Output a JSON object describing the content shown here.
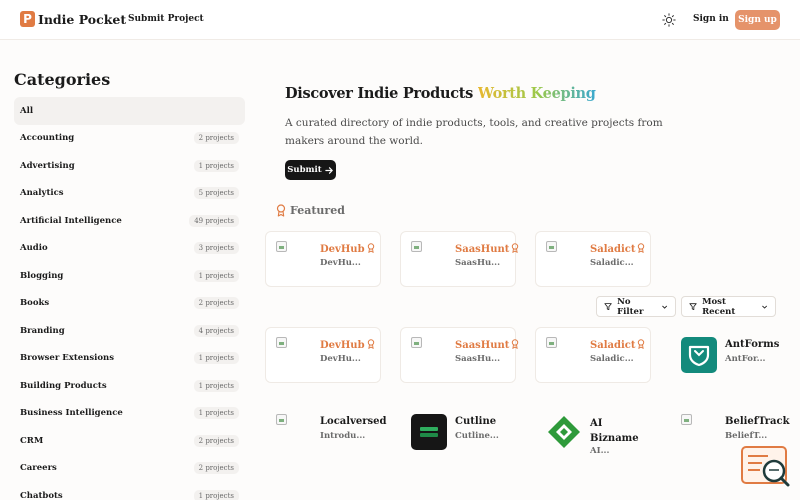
{
  "header": {
    "logo_letter": "P",
    "logo_text": "Indie Pocket",
    "nav_submit": "Submit Project",
    "signin": "Sign in",
    "signup": "Sign up"
  },
  "sidebar": {
    "title": "Categories",
    "items": [
      {
        "name": "All",
        "count": ""
      },
      {
        "name": "Accounting",
        "count": "2 projects"
      },
      {
        "name": "Advertising",
        "count": "1 projects"
      },
      {
        "name": "Analytics",
        "count": "5 projects"
      },
      {
        "name": "Artificial Intelligence",
        "count": "49 projects"
      },
      {
        "name": "Audio",
        "count": "3 projects"
      },
      {
        "name": "Blogging",
        "count": "1 projects"
      },
      {
        "name": "Books",
        "count": "2 projects"
      },
      {
        "name": "Branding",
        "count": "4 projects"
      },
      {
        "name": "Browser Extensions",
        "count": "1 projects"
      },
      {
        "name": "Building Products",
        "count": "1 projects"
      },
      {
        "name": "Business Intelligence",
        "count": "1 projects"
      },
      {
        "name": "CRM",
        "count": "2 projects"
      },
      {
        "name": "Careers",
        "count": "2 projects"
      },
      {
        "name": "Chatbots",
        "count": "1 projects"
      }
    ]
  },
  "hero": {
    "title_main": "Discover Indie Products ",
    "title_highlight": "Worth Keeping",
    "description": "A curated directory of indie products, tools, and creative projects from makers around the world.",
    "submit_label": "Submit"
  },
  "featured": {
    "label": "Featured",
    "cards": [
      {
        "name": "DevHub",
        "sub": "DevHu..."
      },
      {
        "name": "SaasHunt",
        "sub": "SaasHu..."
      },
      {
        "name": "Saladict",
        "sub": "Saladic..."
      }
    ]
  },
  "filters": {
    "filter_label": "No Filter",
    "sort_label": "Most Recent"
  },
  "grid": {
    "row1": [
      {
        "name": "DevHub",
        "sub": "DevHu..."
      },
      {
        "name": "SaasHunt",
        "sub": "SaasHu..."
      },
      {
        "name": "Saladict",
        "sub": "Saladic..."
      },
      {
        "name": "AntForms",
        "sub": "AntFor..."
      }
    ],
    "row2": [
      {
        "name": "Localversed",
        "sub": "Introdu..."
      },
      {
        "name": "Cutline",
        "sub": "Cutline..."
      },
      {
        "name_line1": "AI",
        "name_line2": "Bizname",
        "sub": "AI..."
      },
      {
        "name": "BeliefTrack",
        "sub": "BeliefT..."
      }
    ]
  },
  "colors": {
    "accent": "#e07b43",
    "signup_bg": "#e5936a",
    "antforms_bg": "#138a7c",
    "ai_bizname_green": "#2e9a3a"
  }
}
